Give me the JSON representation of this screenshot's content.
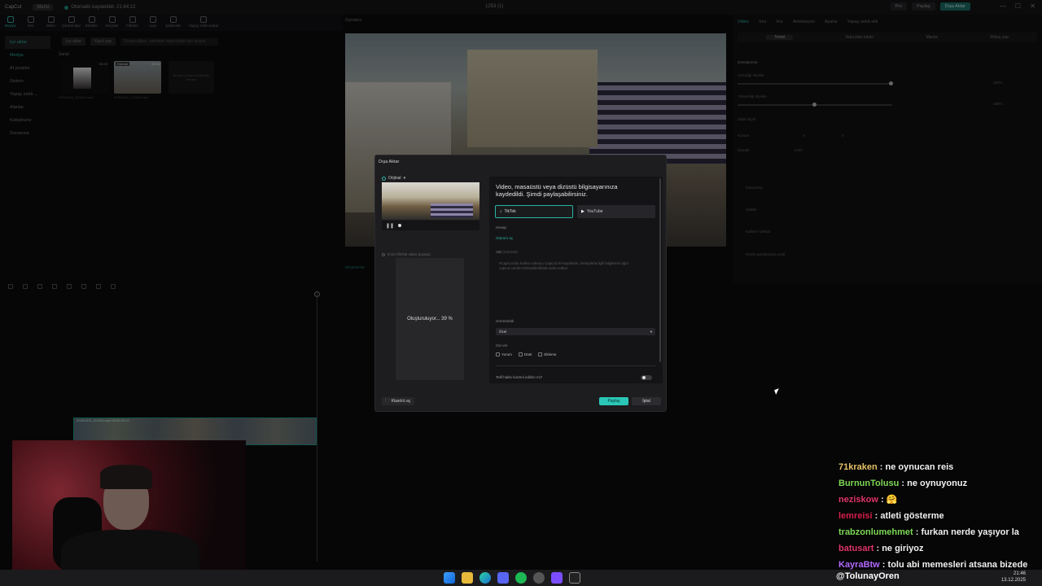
{
  "titlebar": {
    "app_name": "CapCut",
    "menu_label": "Menü",
    "project_status": "Otomatik kaydedildi: 21:44:12",
    "center_title": "1253 (1)",
    "pro_label": "Pro",
    "share_label": "Paylaş",
    "export_label": "Dışa Aktar"
  },
  "toolbar": {
    "items": [
      "Medya",
      "Ses",
      "Metin",
      "Çıkartmalar",
      "Efektler",
      "Geçişler",
      "Filtreler",
      "Ayar",
      "Şablonlar",
      "Yapay zekâ avatar"
    ]
  },
  "leftnav": {
    "items": [
      "İçe aktar",
      "Medya",
      "AI projeler",
      "Sistem",
      "Yapay zekâ ...",
      "Alanlar",
      "Kütüphane",
      "Dreamina"
    ]
  },
  "mediabar": {
    "import": "İçe aktar",
    "record": "Kayıt yap",
    "search_placeholder": "Dosya adları, sahneler veya kişiler için arayın",
    "section_label": "Sanal",
    "thumb1_caption": "20251303_123319.mp4",
    "thumb2_caption": "20251303_170403.mp4",
    "thumb1_duration": "00:20",
    "thumb2_duration": "00:16",
    "thumb2_tag": "Eklendi",
    "dropzone_text": "Buraya medya sürükleyip bırakın"
  },
  "player": {
    "header": "Oynatıcı",
    "timecode": "00:00:00:00"
  },
  "inspector": {
    "tabs": [
      "Video",
      "Ses",
      "Hız",
      "Animasyon",
      "Ayarla",
      "Yapay zekâ stili"
    ],
    "subtabs": [
      "Temel",
      "Arka plan kaldır",
      "Maske",
      "Rötuş yap"
    ],
    "section": "Dönüştürme",
    "rows": [
      "Genişliği ölçekle",
      "Yüksekliği ölçekle",
      "Sabit ölçek",
      "Konum",
      "Döndür"
    ],
    "scale_w": "220%",
    "scale_h": "150%",
    "pos_x": "0",
    "pos_y": "0",
    "rotate": "0.00°",
    "extra": [
      "Karıştırma",
      "Sabitle",
      "Kalibre/ iyileştir",
      "Resim gürültüsünü azalt"
    ]
  },
  "modal": {
    "title": "Dışa Aktar",
    "original_label": "Orijinal",
    "tiktok_note": "9:16 (TikTok video boyutu)",
    "generating": "Oluşturuluyor... 39 %",
    "headline": "Video, masaüstü veya dizüstü bilgisayarınıza kaydedildi. Şimdi paylaşabilirsiniz.",
    "tiktok": "TikTok",
    "youtube": "YouTube",
    "account_label": "Hesap",
    "login_link": "Oturum aç",
    "name_label": "Adı",
    "name_counter": "(110/150)",
    "caption_placeholder": "#CapCut Bu harika videoyu CapCut ile kaydettim. Detaylarla ilgili bilgilerimi ağın capcut.com/tr-tr/trendler/tiktok-video-editor",
    "visibility_label": "Görünürlük",
    "visibility_value": "Özel",
    "permission_label": "İzin ver",
    "perm_comment": "Yorum",
    "perm_duet": "Düet",
    "perm_stitch": "Ekleme",
    "copyright_label": "Telif hakkı kontrol edilsin mi?",
    "open_folder": "Klasörü aç",
    "share_btn": "Paylaş",
    "cancel_btn": "İptal"
  },
  "timeline": {
    "clip_label": "20251303_123319.mp4  00:00:20:12"
  },
  "chat": [
    {
      "user": "71kraken",
      "color": "#e8c36a",
      "message": "ne oynucan reis"
    },
    {
      "user": "BurnunTolusu",
      "color": "#7ed957",
      "message": "ne oynuyonuz"
    },
    {
      "user": "neziskow",
      "color": "#e0366a",
      "message": "🤗"
    },
    {
      "user": "lemreisi",
      "color": "#d61f4a",
      "message": "atleti gösterme"
    },
    {
      "user": "trabzonlumehmet",
      "color": "#7ed957",
      "message": "furkan nerde yaşıyor la"
    },
    {
      "user": "batusart",
      "color": "#e0366a",
      "message": "ne giriyoz"
    },
    {
      "user": "KayraBtw",
      "color": "#b36bff",
      "message": "tolu abi memesleri atsana bizede"
    }
  ],
  "handle": "@TolunayOren",
  "clock": {
    "time": "21:46",
    "date": "13.12.2025"
  },
  "taskbar_icons": [
    "windows",
    "file-explorer",
    "edge",
    "discord",
    "spotify",
    "chrome",
    "obs",
    "capcut"
  ]
}
